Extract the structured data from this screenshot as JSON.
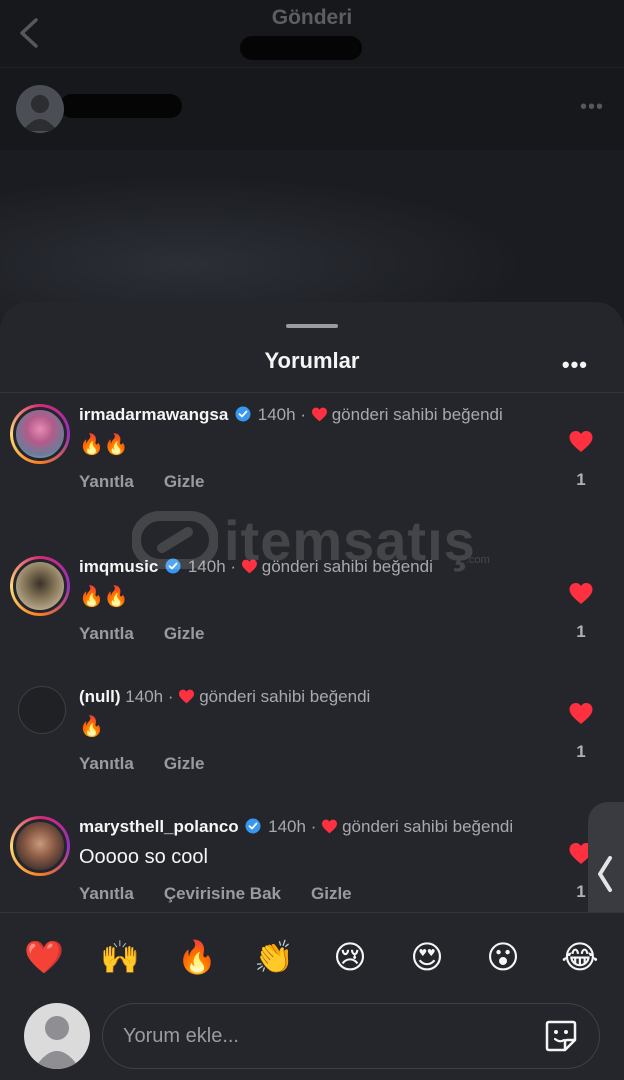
{
  "header": {
    "title": "Gönderi"
  },
  "sheet": {
    "title": "Yorumlar"
  },
  "comments": [
    {
      "username": "irmadarmawangsa",
      "time": "140h",
      "liked_by": "gönderi sahibi beğendi",
      "text": "🔥🔥",
      "reply": "Yanıtla",
      "hide": "Gizle",
      "likes": "1"
    },
    {
      "username": "imqmusic",
      "time": "140h",
      "liked_by": "gönderi sahibi beğendi",
      "text": "🔥🔥",
      "reply": "Yanıtla",
      "hide": "Gizle",
      "likes": "1"
    },
    {
      "username": "(null)",
      "time": "140h",
      "liked_by": "gönderi sahibi beğendi",
      "text": "🔥",
      "reply": "Yanıtla",
      "hide": "Gizle",
      "likes": "1"
    },
    {
      "username": "marysthell_polanco",
      "time": "140h",
      "liked_by": "gönderi sahibi beğendi",
      "text": "Ooooo so cool",
      "reply": "Yanıtla",
      "translate": "Çevirisine Bak",
      "hide": "Gizle",
      "likes": "1"
    }
  ],
  "watermark": {
    "text": "itemsatış",
    "suffix": ".com"
  },
  "emoji_bar": [
    "❤️",
    "🙌",
    "🔥",
    "👏",
    "😢",
    "😍",
    "😮",
    "😂"
  ],
  "composer": {
    "placeholder": "Yorum ekle..."
  },
  "colors": {
    "sheet_bg": "#25262b",
    "like_red": "#ff3040",
    "verified_blue": "#3897f0"
  }
}
